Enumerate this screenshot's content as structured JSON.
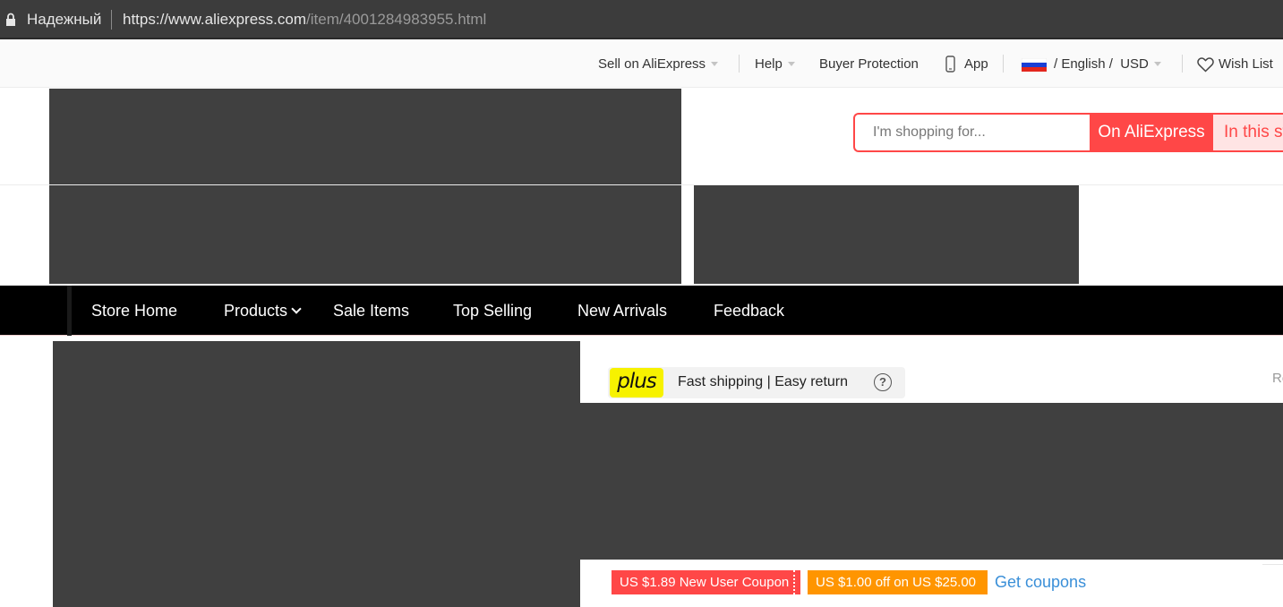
{
  "browser": {
    "secure_label": "Надежный",
    "url_host": "https://www.aliexpress.com",
    "url_path": "/item/4001284983955.html"
  },
  "topnav": {
    "sell": "Sell on AliExpress",
    "help": "Help",
    "buyer_protection": "Buyer Protection",
    "app": "App",
    "language": "/ English /",
    "currency": "USD",
    "wish_list": "Wish List"
  },
  "search": {
    "placeholder": "I'm shopping for...",
    "on_aliexpress": "On AliExpress",
    "in_this_store": "In this st"
  },
  "store_nav": {
    "items": [
      "Store Home",
      "Products",
      "Sale Items",
      "Top Selling",
      "New Arrivals",
      "Feedback"
    ]
  },
  "product": {
    "plus_badge": "plus",
    "plus_text": "Fast shipping | Easy return",
    "help_glyph": "?",
    "corner_text": "Re",
    "coupons": [
      "US $1.89 New User Coupon",
      "US $1.00 off on US $25.00"
    ],
    "get_coupons": "Get coupons"
  },
  "colors": {
    "accent": "#ff4747",
    "coupon_orange": "#ff9500",
    "plus_yellow": "#f7f200",
    "link_blue": "#3a8fd8",
    "redacted": "#404040"
  }
}
